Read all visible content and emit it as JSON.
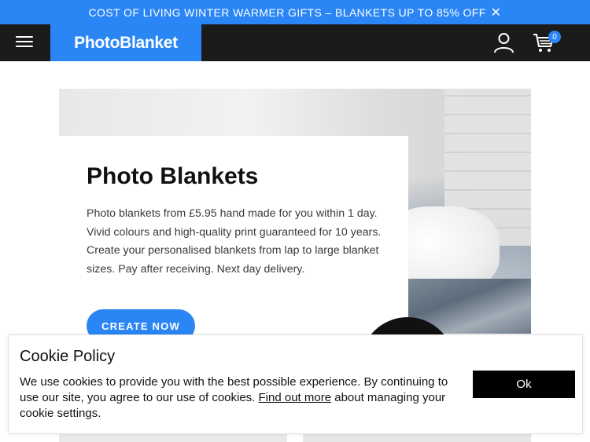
{
  "promo": {
    "text": "COST OF LIVING WINTER WARMER GIFTS – BLANKETS UP TO 85% OFF",
    "close_glyph": "✕"
  },
  "header": {
    "logo": "PhotoBlanket",
    "cart_count": "0",
    "icons": [
      "menu-icon",
      "user-icon",
      "cart-icon"
    ]
  },
  "hero": {
    "title": "Photo Blankets",
    "text": "Photo blankets from £5.95 hand made for you within 1 day. Vivid colours and high-quality print guaranteed for 10 years. Create your personalised blankets from lap to large blanket sizes. Pay after receiving. Next day delivery.",
    "button_label": "CREATE NOW"
  },
  "cookie": {
    "title": "Cookie Policy",
    "text_before": "We use cookies to provide you with the best possible experience. By continuing to use our site, you agree to our use of cookies. ",
    "link_text": "Find out more",
    "text_after": " about managing your cookie settings.",
    "ok_label": "Ok"
  },
  "colors": {
    "accent": "#2a86f5",
    "header_bg": "#1b1b1b",
    "button_dark": "#000000"
  }
}
